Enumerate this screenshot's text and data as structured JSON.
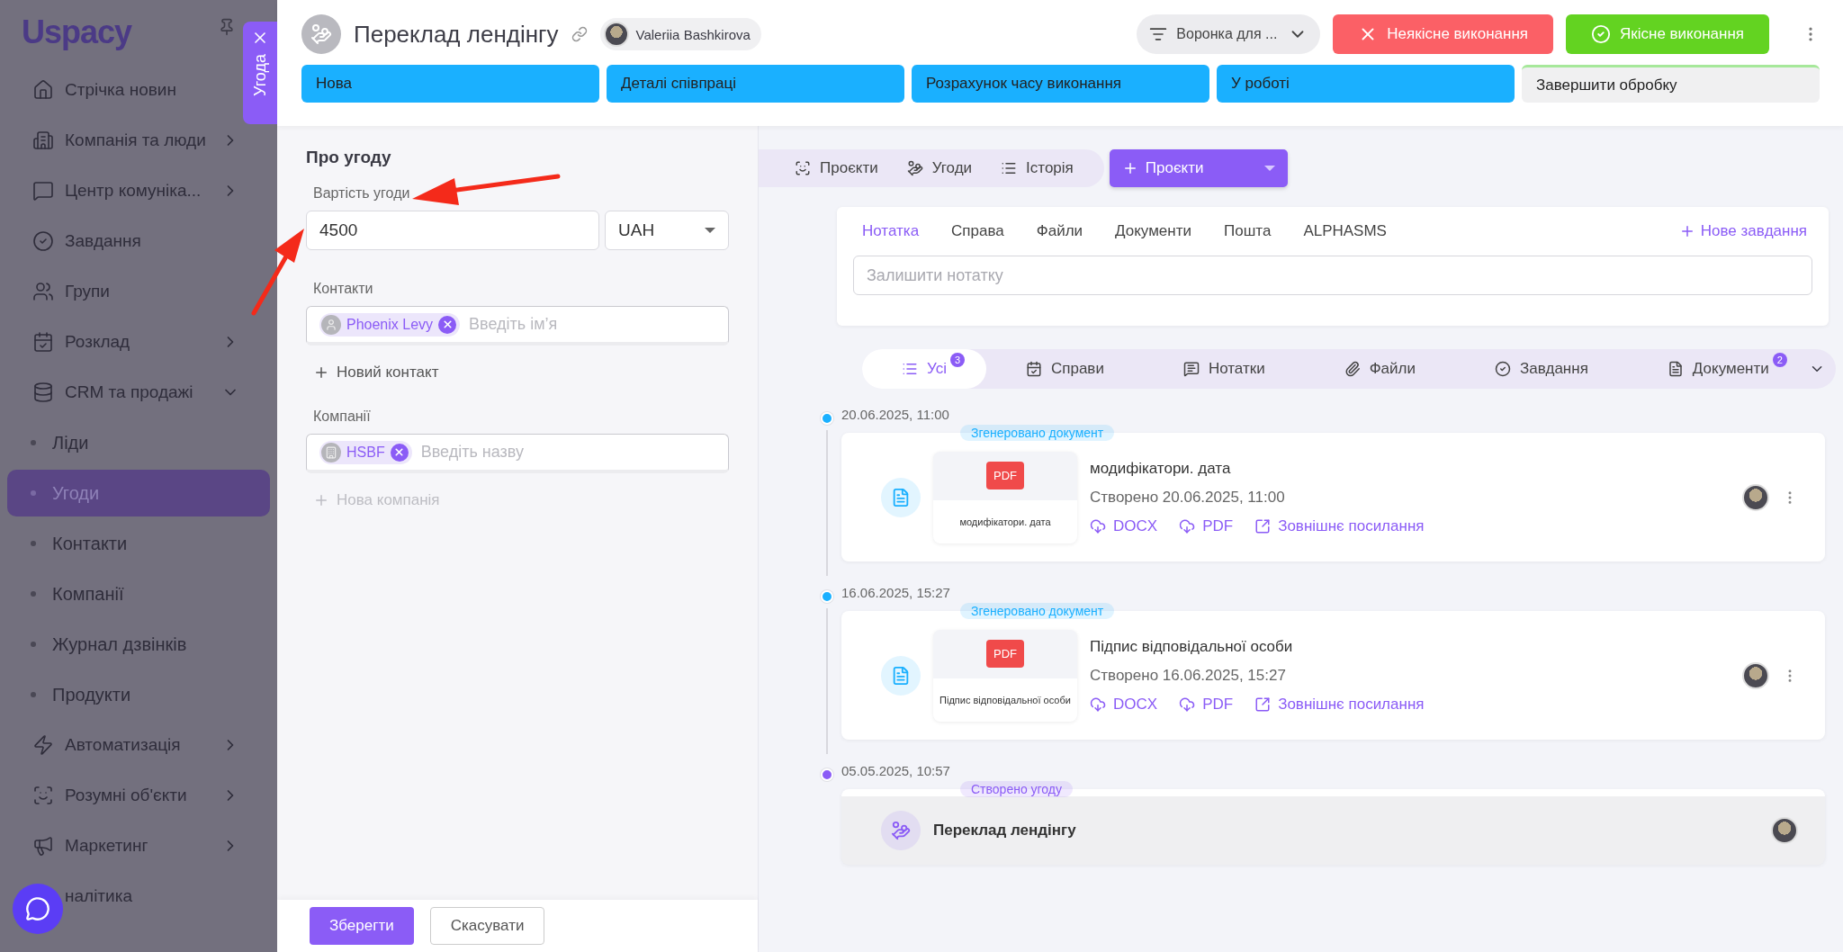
{
  "sidebar": {
    "logo": "Uspacy",
    "items": [
      {
        "label": "Стрічка новин"
      },
      {
        "label": "Компанія та люди",
        "expanded": false
      },
      {
        "label": "Центр комуніка...",
        "expanded": false
      },
      {
        "label": "Завдання"
      },
      {
        "label": "Групи"
      },
      {
        "label": "Розклад",
        "expanded": false
      },
      {
        "label": "CRM та продажі",
        "expanded": true,
        "children": [
          {
            "label": "Ліди",
            "selected": false
          },
          {
            "label": "Угоди",
            "selected": true
          },
          {
            "label": "Контакти",
            "selected": false
          },
          {
            "label": "Компанії",
            "selected": false
          },
          {
            "label": "Журнал дзвінків",
            "selected": false
          },
          {
            "label": "Продукти",
            "selected": false
          }
        ]
      },
      {
        "label": "Автоматизація",
        "expanded": false
      },
      {
        "label": "Розумні об'єкти",
        "expanded": false
      },
      {
        "label": "Маркетинг",
        "expanded": false
      },
      {
        "label": "налітика"
      }
    ]
  },
  "side_tab": {
    "label": "Угода"
  },
  "header": {
    "title": "Переклад лендінгу",
    "owner": "Valeriia Bashkirova",
    "pipeline": "Воронка для ...",
    "fail_button": "Неякісне виконання",
    "success_button": "Якісне виконання"
  },
  "stages": [
    {
      "label": "Нова",
      "reached": true
    },
    {
      "label": "Деталі співпраці",
      "reached": true
    },
    {
      "label": "Розрахунок часу виконання",
      "reached": true
    },
    {
      "label": "У роботі",
      "reached": true
    },
    {
      "label": "Завершити обробку",
      "reached": false
    }
  ],
  "form": {
    "title": "Про угоду",
    "amount": {
      "label": "Вартість угоди",
      "value": "4500",
      "currency": "UAH"
    },
    "contacts": {
      "label": "Контакти",
      "chips": [
        "Phoenix Levy"
      ],
      "placeholder": "Введіть ім’я",
      "add": {
        "label": "Новий контакт",
        "disabled": false
      }
    },
    "companies": {
      "label": "Компанії",
      "chips": [
        "HSBF"
      ],
      "placeholder": "Введіть назву",
      "add": {
        "label": "Нова компанія",
        "disabled": true
      }
    },
    "save": "Зберегти",
    "cancel": "Скасувати"
  },
  "related_tabs": [
    {
      "label": "Проєкти",
      "selected": false
    },
    {
      "label": "Угоди",
      "selected": false
    },
    {
      "label": "Історія",
      "selected": false
    }
  ],
  "add_button": "Проєкти",
  "composer": {
    "tabs": [
      {
        "label": "Нотатка",
        "selected": true
      },
      {
        "label": "Справа",
        "selected": false
      },
      {
        "label": "Файли",
        "selected": false
      },
      {
        "label": "Документи",
        "selected": false
      },
      {
        "label": "Пошта",
        "selected": false
      },
      {
        "label": "ALPHASMS",
        "selected": false
      }
    ],
    "new_task": "Нове завдання",
    "placeholder": "Залишити нотатку"
  },
  "filters": [
    {
      "label": "Усі",
      "selected": true,
      "count": "3"
    },
    {
      "label": "Справи",
      "selected": false
    },
    {
      "label": "Нотатки",
      "selected": false
    },
    {
      "label": "Файли",
      "selected": false
    },
    {
      "label": "Завдання",
      "selected": false
    },
    {
      "label": "Документи",
      "selected": false,
      "count": "2"
    }
  ],
  "timeline": [
    {
      "kind": "document",
      "date": "20.06.2025, 11:00",
      "color": "#1ab0ff",
      "badge": "Згенеровано документ",
      "thumb_label": "PDF",
      "thumb_caption": "модифікатори. дата",
      "title": "модифікатори. дата",
      "created": "Створено 20.06.2025, 11:00",
      "links": [
        "DOCX",
        "PDF",
        "Зовнішнє посилання"
      ]
    },
    {
      "kind": "document",
      "date": "16.06.2025, 15:27",
      "color": "#1ab0ff",
      "badge": "Згенеровано документ",
      "thumb_label": "PDF",
      "thumb_caption": "Підпис відповідальної особи",
      "title": "Підпис відповідальної особи",
      "created": "Створено 16.06.2025, 15:27",
      "links": [
        "DOCX",
        "PDF",
        "Зовнішнє посилання"
      ]
    },
    {
      "kind": "deal",
      "date": "05.05.2025, 10:57",
      "color": "#8b5cf6",
      "badge": "Створено угоду",
      "title": "Переклад лендінгу"
    }
  ]
}
